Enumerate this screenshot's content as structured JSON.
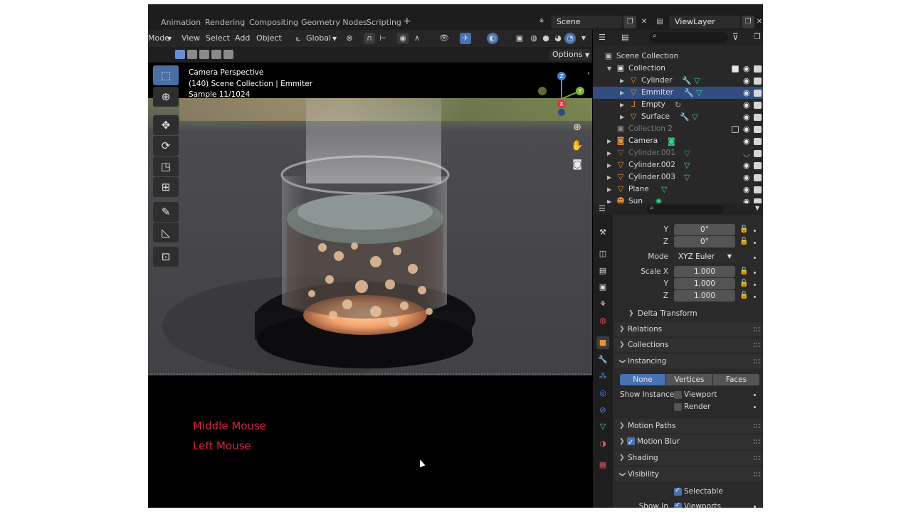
{
  "workspace_tabs": [
    "Animation",
    "Rendering",
    "Compositing",
    "Geometry Nodes",
    "Scripting"
  ],
  "add_workspace": "+",
  "scene": "Scene",
  "view_layer": "ViewLayer",
  "viewport_header": {
    "mode": "Mode",
    "menus": [
      "View",
      "Select",
      "Add",
      "Object"
    ],
    "orientation": "Global",
    "options": "Options"
  },
  "viewport": {
    "info_lines": [
      "Camera Perspective",
      "(140) Scene Collection | Emmiter",
      "Sample 11/1024"
    ],
    "gizmo_axes": [
      "Z",
      "Y",
      "X"
    ],
    "overlay_labels": [
      "Middle Mouse",
      "Left Mouse"
    ]
  },
  "outliner": {
    "rows": [
      {
        "label": "Scene Collection",
        "icon": "scene-collection-icon",
        "depth": 0
      },
      {
        "label": "Collection",
        "icon": "collection-icon",
        "depth": 1,
        "checked": true
      },
      {
        "label": "Cylinder",
        "icon": "mesh-icon",
        "depth": 2
      },
      {
        "label": "Emmiter",
        "icon": "mesh-icon",
        "depth": 2,
        "selected": true
      },
      {
        "label": "Empty",
        "icon": "empty-icon",
        "depth": 2
      },
      {
        "label": "Surface",
        "icon": "mesh-icon",
        "depth": 2
      },
      {
        "label": "Collection 2",
        "icon": "collection-icon",
        "depth": 1,
        "dim": true,
        "checked": false
      },
      {
        "label": "Camera",
        "icon": "camera-icon",
        "depth": 1
      },
      {
        "label": "Cylinder.001",
        "icon": "mesh-icon",
        "depth": 1,
        "dim": true
      },
      {
        "label": "Cylinder.002",
        "icon": "mesh-icon",
        "depth": 1
      },
      {
        "label": "Cylinder.003",
        "icon": "mesh-icon",
        "depth": 1
      },
      {
        "label": "Plane",
        "icon": "mesh-icon",
        "depth": 1
      },
      {
        "label": "Sun",
        "icon": "light-icon",
        "depth": 1
      }
    ]
  },
  "properties": {
    "rotation": {
      "y_label": "Y",
      "y": "0°",
      "z_label": "Z",
      "z": "0°"
    },
    "mode_label": "Mode",
    "mode_value": "XYZ Euler",
    "scale": {
      "x_label": "Scale X",
      "x": "1.000",
      "y_label": "Y",
      "y": "1.000",
      "z_label": "Z",
      "z": "1.000"
    },
    "delta_transform": "Delta Transform",
    "panels": {
      "relations": "Relations",
      "collections": "Collections",
      "instancing": "Instancing",
      "motion_paths": "Motion Paths",
      "motion_blur": "Motion Blur",
      "shading": "Shading",
      "visibility": "Visibility"
    },
    "instancing_options": [
      "None",
      "Vertices",
      "Faces"
    ],
    "show_instancer_label": "Show Instancer",
    "show_instancer_viewport": "Viewport",
    "show_instancer_render": "Render",
    "selectable": "Selectable",
    "show_in_label": "Show In",
    "viewports": "Viewports"
  },
  "colors": {
    "accent_blue": "#4772b3",
    "selected_row": "#334d80",
    "overlay_red": "#d8203f",
    "mesh_orange": "#e8913a",
    "modifier_blue": "#4d8fe0",
    "data_green": "#3fcf84"
  }
}
